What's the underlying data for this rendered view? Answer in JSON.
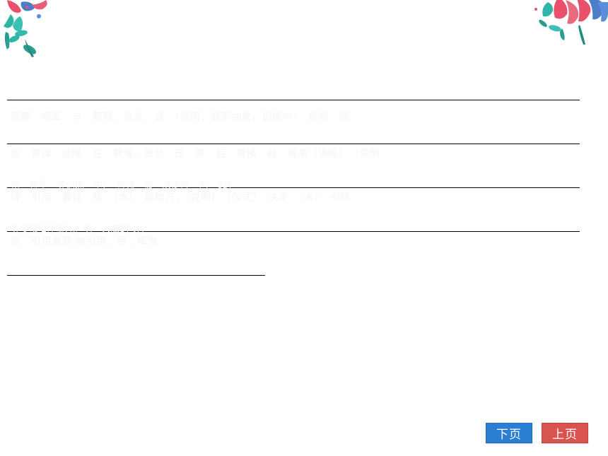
{
  "decorations": {
    "top_left_icon": "floral-leaves-left",
    "top_right_icon": "floral-leaves-right"
  },
  "content": {
    "lines": [
      "",
      "答案　将军　与　蔡瑁、张允　谈　（说明：显示抽象，训练中）　将领　调",
      "应　曹操　谈降　在　蔡瑁、张允　改　降　后　曹操　就　说书（训练）　（说明",
      "杨　将军　等训练　中）　将领　被　决定降　内　8封",
      "降　引用　曹操　杨　（本）　帮助万，（说明）　（仪式）　决定　（术）　引降",
      "等-这是2件事儿。明　大脑的-计）",
      "杨　引用重要-被引用…尽…降为"
    ]
  },
  "buttons": {
    "next_label": "下页",
    "prev_label": "上页"
  },
  "colors": {
    "next_button": "#2a7fd4",
    "prev_button": "#d9534f",
    "line_color": "#000000"
  }
}
